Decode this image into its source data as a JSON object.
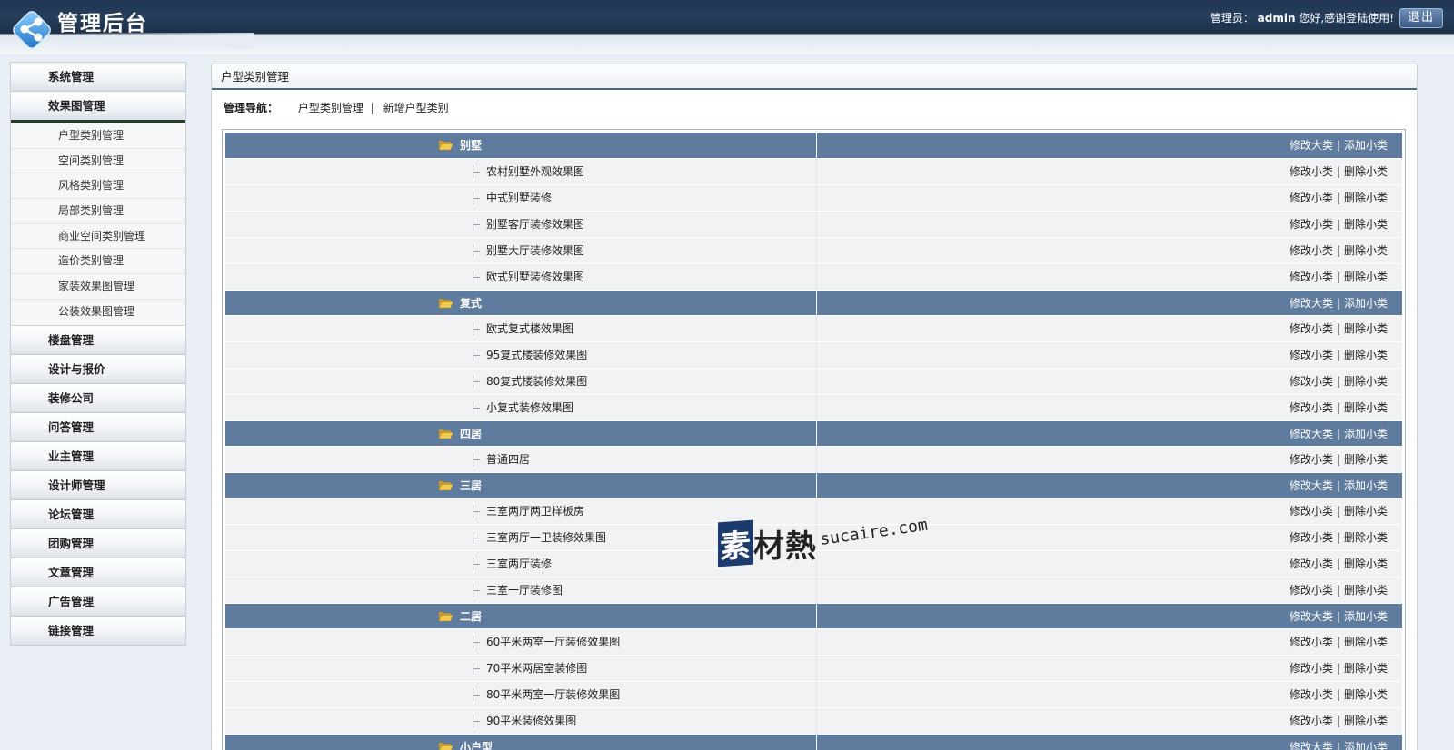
{
  "header": {
    "title": "管理后台",
    "admin_label": "管理员：",
    "admin_name": "admin",
    "welcome": "您好,感谢登陆使用!",
    "logout": "退出"
  },
  "sidebar": {
    "items_top": [
      {
        "label": "系统管理"
      },
      {
        "label": "效果图管理",
        "active": true
      }
    ],
    "subitems": [
      {
        "label": "户型类别管理"
      },
      {
        "label": "空间类别管理"
      },
      {
        "label": "风格类别管理"
      },
      {
        "label": "局部类别管理"
      },
      {
        "label": "商业空间类别管理"
      },
      {
        "label": "造价类别管理"
      },
      {
        "label": "家装效果图管理"
      },
      {
        "label": "公装效果图管理"
      }
    ],
    "items_bottom": [
      {
        "label": "楼盘管理"
      },
      {
        "label": "设计与报价"
      },
      {
        "label": "装修公司"
      },
      {
        "label": "问答管理"
      },
      {
        "label": "业主管理"
      },
      {
        "label": "设计师管理"
      },
      {
        "label": "论坛管理"
      },
      {
        "label": "团购管理"
      },
      {
        "label": "文章管理"
      },
      {
        "label": "广告管理"
      },
      {
        "label": "链接管理"
      }
    ]
  },
  "main": {
    "title": "户型类别管理",
    "nav_label": "管理导航：",
    "nav_links": [
      "户型类别管理",
      "新增户型类别"
    ],
    "nav_sep": "|",
    "cat_actions": [
      "修改大类",
      "添加小类"
    ],
    "sub_actions": [
      "修改小类",
      "删除小类"
    ],
    "action_sep": "|",
    "categories": [
      {
        "name": "别墅",
        "subs": [
          "农村别墅外观效果图",
          "中式别墅装修",
          "别墅客厅装修效果图",
          "别墅大厅装修效果图",
          "欧式别墅装修效果图"
        ]
      },
      {
        "name": "复式",
        "subs": [
          "欧式复式楼效果图",
          "95复式楼装修效果图",
          "80复式楼装修效果图",
          "小复式装修效果图"
        ]
      },
      {
        "name": "四居",
        "subs": [
          "普通四居"
        ]
      },
      {
        "name": "三居",
        "subs": [
          "三室两厅两卫样板房",
          "三室两厅一卫装修效果图",
          "三室两厅装修",
          "三室一厅装修图"
        ]
      },
      {
        "name": "二居",
        "subs": [
          "60平米两室一厅装修效果图",
          "70平米两居室装修图",
          "80平米两室一厅装修效果图",
          "90平米装修效果图"
        ]
      },
      {
        "name": "小户型",
        "subs": []
      }
    ]
  },
  "watermark": {
    "brand_first": "素",
    "brand_rest": "材熱",
    "url": "sucaire.com"
  },
  "colors": {
    "header_bg": "#1f3550",
    "category_row": "#5f7b9e",
    "sub_row": "#f1f2f4",
    "folder": "#e8b83a"
  }
}
